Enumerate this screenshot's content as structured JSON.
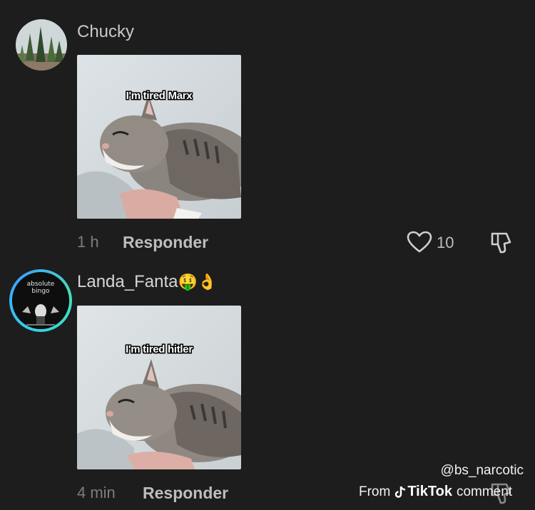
{
  "comments": [
    {
      "username": "Chucky",
      "image_caption": "I'm tired Marx",
      "time": "1 h",
      "reply_label": "Responder",
      "likes": "10"
    },
    {
      "username": "Landa_Fanta",
      "username_emojis": "🤑👌",
      "avatar_text": "absolute bingo",
      "image_caption": "I'm tired hitler",
      "time": "4 min",
      "reply_label": "Responder"
    }
  ],
  "watermark": {
    "handle": "@bs_narcotic",
    "prefix": "From",
    "brand": "TikTok",
    "suffix": "comment"
  },
  "colors": {
    "background": "#1d1d1d",
    "ring_accent": "#2fd3e8"
  }
}
